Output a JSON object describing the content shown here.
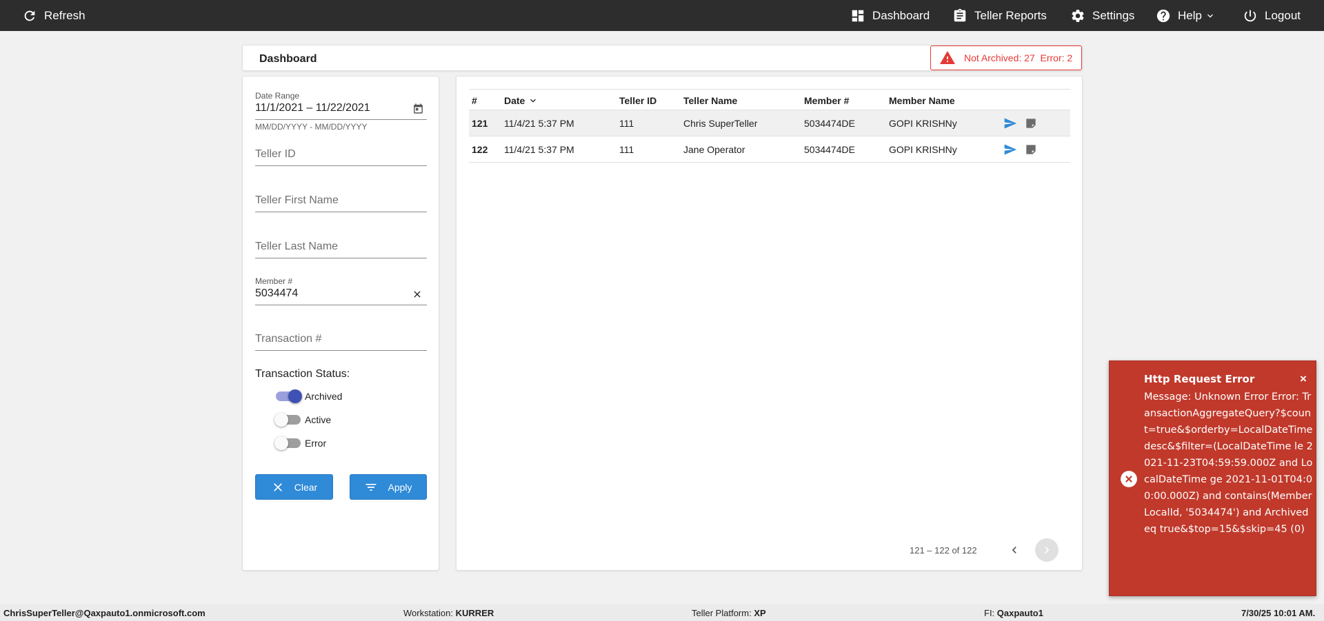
{
  "topbar": {
    "refresh": "Refresh",
    "dashboard": "Dashboard",
    "teller_reports": "Teller Reports",
    "settings": "Settings",
    "help": "Help",
    "logout": "Logout"
  },
  "dashboard": {
    "title": "Dashboard",
    "alert": "Not Archived: 27  Error: 2"
  },
  "filters": {
    "date_range_label": "Date Range",
    "date_range_value": "11/1/2021 – 11/22/2021",
    "date_hint": "MM/DD/YYYY - MM/DD/YYYY",
    "teller_id_placeholder": "Teller ID",
    "teller_first_name_placeholder": "Teller First Name",
    "teller_last_name_placeholder": "Teller Last Name",
    "member_label": "Member #",
    "member_value": "5034474",
    "transaction_placeholder": "Transaction #",
    "status_label": "Transaction Status:",
    "statuses": [
      {
        "label": "Archived",
        "on": true
      },
      {
        "label": "Active",
        "on": false
      },
      {
        "label": "Error",
        "on": false
      }
    ],
    "clear_label": "Clear",
    "apply_label": "Apply"
  },
  "table": {
    "columns": [
      "#",
      "Date",
      "Teller ID",
      "Teller Name",
      "Member #",
      "Member Name"
    ],
    "rows": [
      {
        "num": "121",
        "date": "11/4/21 5:37 PM",
        "teller_id": "111",
        "teller_name": "Chris SuperTeller",
        "member": "5034474DE",
        "member_name": "GOPI KRISHNy"
      },
      {
        "num": "122",
        "date": "11/4/21 5:37 PM",
        "teller_id": "111",
        "teller_name": "Jane Operator",
        "member": "5034474DE",
        "member_name": "GOPI KRISHNy"
      }
    ],
    "pager": "121 – 122 of 122"
  },
  "toast": {
    "title": "Http Request Error",
    "message": "Message: Unknown Error Error: TransactionAggregateQuery?$count=true&$orderby=LocalDateTime desc&$filter=(LocalDateTime le 2021-11-23T04:59:59.000Z and LocalDateTime ge 2021-11-01T04:00:00.000Z) and contains(MemberLocalId, '5034474') and Archived eq true&$top=15&$skip=45 (0)",
    "close": "×"
  },
  "statusbar": {
    "user": "ChrisSuperTeller@Qaxpauto1.onmicrosoft.com",
    "workstation_label": "Workstation:",
    "workstation": "KURRER",
    "platform_label": "Teller Platform:",
    "platform": "XP",
    "fi_label": "FI:",
    "fi": "Qaxpauto1",
    "timestamp": "7/30/25 10:01 AM."
  },
  "colors": {
    "topbar": "#2d2d2d",
    "accent": "#2f8ad8",
    "error": "#c0392b",
    "toggle_on": "#3f51b5"
  }
}
